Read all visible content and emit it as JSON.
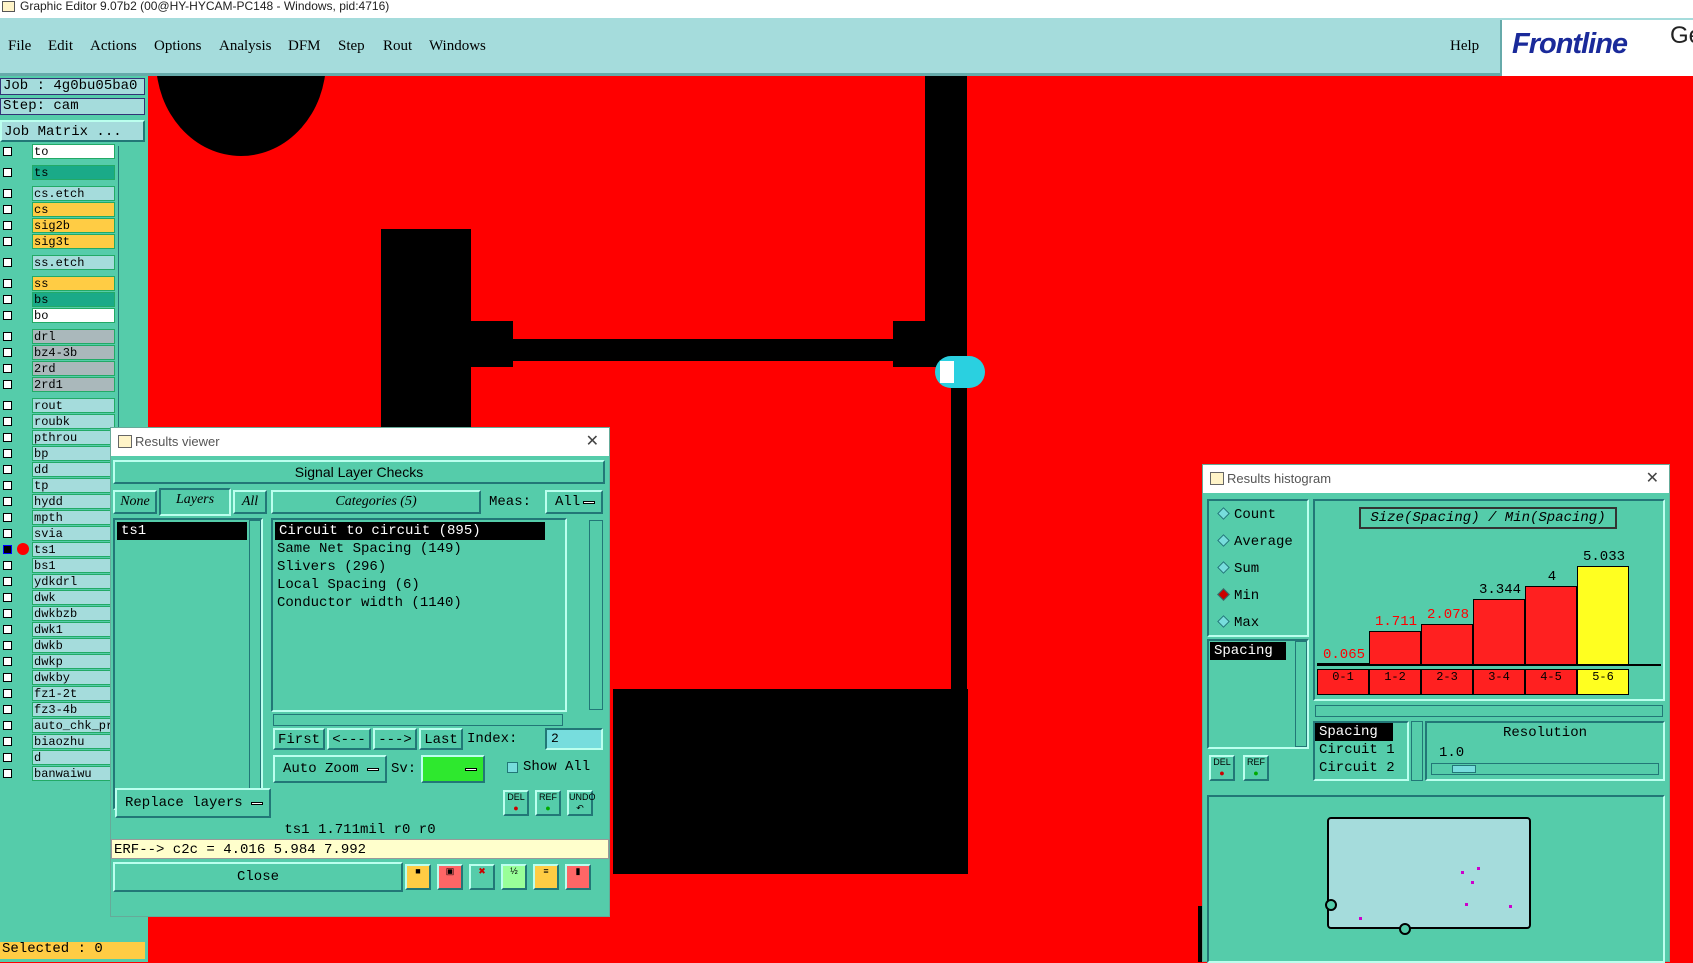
{
  "window_title": "Graphic Editor 9.07b2 (00@HY-HYCAM-PC148 - Windows, pid:4716)",
  "menu": [
    "File",
    "Edit",
    "Actions",
    "Options",
    "Analysis",
    "DFM",
    "Step",
    "Rout",
    "Windows"
  ],
  "help": "Help",
  "logo": {
    "text": "Frontline",
    "suffix": "Ge"
  },
  "sidebar": {
    "job": "Job : 4g0bu05ba0",
    "step": "Step: cam",
    "job_matrix": "Job Matrix ...",
    "selected": "Selected : 0",
    "layers": [
      {
        "name": "to",
        "color": "#ffffff"
      },
      {
        "name": "ts",
        "color": "#1aaa88"
      },
      {
        "name": "cs.etch",
        "color": "#a5dcdc"
      },
      {
        "name": "cs",
        "color": "#ffcc44"
      },
      {
        "name": "sig2b",
        "color": "#ffcc44"
      },
      {
        "name": "sig3t",
        "color": "#ffcc44"
      },
      {
        "name": "ss.etch",
        "color": "#a5dcdc"
      },
      {
        "name": "ss",
        "color": "#ffcc44"
      },
      {
        "name": "bs",
        "color": "#1aaa88"
      },
      {
        "name": "bo",
        "color": "#ffffff"
      },
      {
        "name": "drl",
        "color": "#aab8bb"
      },
      {
        "name": "bz4-3b",
        "color": "#aab8bb"
      },
      {
        "name": "2rd",
        "color": "#aab8bb"
      },
      {
        "name": "2rd1",
        "color": "#aab8bb"
      },
      {
        "name": "rout",
        "color": "#a5dcdc"
      },
      {
        "name": "roubk",
        "color": "#a5dcdc"
      },
      {
        "name": "pthrou",
        "color": "#a5dcdc"
      },
      {
        "name": "bp",
        "color": "#a5dcdc"
      },
      {
        "name": "dd",
        "color": "#a5dcdc"
      },
      {
        "name": "tp",
        "color": "#a5dcdc"
      },
      {
        "name": "hydd",
        "color": "#a5dcdc"
      },
      {
        "name": "mpth",
        "color": "#a5dcdc"
      },
      {
        "name": "svia",
        "color": "#a5dcdc"
      },
      {
        "name": "ts1",
        "color": "#a5dcdc"
      },
      {
        "name": "bs1",
        "color": "#a5dcdc"
      },
      {
        "name": "ydkdrl",
        "color": "#a5dcdc"
      },
      {
        "name": "dwk",
        "color": "#a5dcdc"
      },
      {
        "name": "dwkbzb",
        "color": "#a5dcdc"
      },
      {
        "name": "dwk1",
        "color": "#a5dcdc"
      },
      {
        "name": "dwkb",
        "color": "#a5dcdc"
      },
      {
        "name": "dwkp",
        "color": "#a5dcdc"
      },
      {
        "name": "dwkby",
        "color": "#a5dcdc"
      },
      {
        "name": "fz1-2t",
        "color": "#a5dcdc"
      },
      {
        "name": "fz3-4b",
        "color": "#a5dcdc"
      },
      {
        "name": "auto_chk_pr",
        "color": "#a5dcdc"
      },
      {
        "name": "biaozhu",
        "color": "#a5dcdc"
      },
      {
        "name": "d",
        "color": "#a5dcdc"
      },
      {
        "name": "banwaiwu",
        "color": "#a5dcdc"
      }
    ]
  },
  "results_viewer": {
    "title": "Results viewer",
    "header": "Signal Layer Checks",
    "none_btn": "None",
    "layers_btn": "Layers",
    "all_btn": "All",
    "categories_btn": "Categories (5)",
    "meas_label": "Meas:",
    "meas_value": "All",
    "layer_items": [
      "ts1"
    ],
    "categories": [
      "Circuit to circuit (895)",
      "Same Net Spacing (149)",
      "Slivers (296)",
      "Local Spacing (6)",
      "Conductor width (1140)"
    ],
    "first": "First",
    "prev": "<---",
    "next": "--->",
    "last": "Last",
    "index_label": "Index:",
    "index_value": "2",
    "auto_zoom": "Auto Zoom",
    "sv_label": "Sv:",
    "show_all": "Show All",
    "replace_layers": "Replace layers",
    "del": "DEL",
    "ref": "REF",
    "undo": "UNDO",
    "status": "ts1 1.711mil  r0  r0",
    "erf": "ERF--> c2c = 4.016 5.984 7.992",
    "close": "Close"
  },
  "histogram": {
    "title": "Results histogram",
    "chart_title": "Size(Spacing) / Min(Spacing)",
    "options": [
      "Count",
      "Average",
      "Sum",
      "Min",
      "Max"
    ],
    "selected_option": "Min",
    "list": [
      "Spacing"
    ],
    "del": "DEL",
    "ref": "REF",
    "sub_list": [
      "Spacing",
      "Circuit 1",
      "Circuit 2"
    ],
    "resolution_label": "Resolution",
    "resolution_value": "1.0",
    "chart_data": {
      "type": "bar",
      "categories": [
        "0-1",
        "1-2",
        "2-3",
        "3-4",
        "4-5",
        "5-6"
      ],
      "values": [
        0.065,
        1.711,
        2.078,
        3.344,
        4,
        5.033
      ],
      "labels": [
        "0.065",
        "1.711",
        "2.078",
        "3.344",
        "4",
        "5.033"
      ],
      "ylim": [
        0,
        5.5
      ],
      "colors": [
        "#ff2020",
        "#ff2020",
        "#ff2020",
        "#ff2020",
        "#ff2020",
        "#ffff20"
      ],
      "label_colors": [
        "#ff0000",
        "#ff0000",
        "#ff0000",
        "#000000",
        "#000000",
        "#000000"
      ]
    }
  }
}
